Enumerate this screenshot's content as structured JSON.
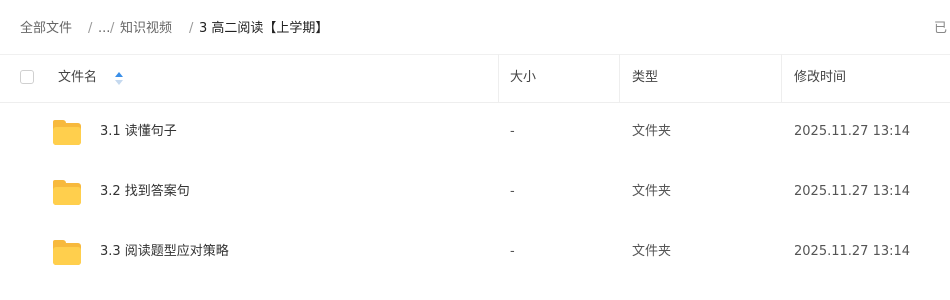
{
  "breadcrumb": {
    "root": "全部文件",
    "sep1": "/",
    "ellipsis": "...",
    "sep2": "/",
    "parent": "知识视频",
    "sep3": "/",
    "current": "3 高二阅读【上学期】",
    "right_text": "已"
  },
  "table": {
    "columns": {
      "name": "文件名",
      "size": "大小",
      "type": "类型",
      "modified": "修改时间"
    },
    "rows": [
      {
        "name": "3.1 读懂句子",
        "size": "-",
        "type": "文件夹",
        "modified": "2025.11.27 13:14"
      },
      {
        "name": "3.2 找到答案句",
        "size": "-",
        "type": "文件夹",
        "modified": "2025.11.27 13:14"
      },
      {
        "name": "3.3 阅读题型应对策略",
        "size": "-",
        "type": "文件夹",
        "modified": "2025.11.27 13:14"
      }
    ]
  },
  "icons": {
    "folder": "folder-icon",
    "sort": "sort-icon"
  },
  "colors": {
    "accent": "#3a8fe8",
    "folder": "#ffcf4d"
  }
}
